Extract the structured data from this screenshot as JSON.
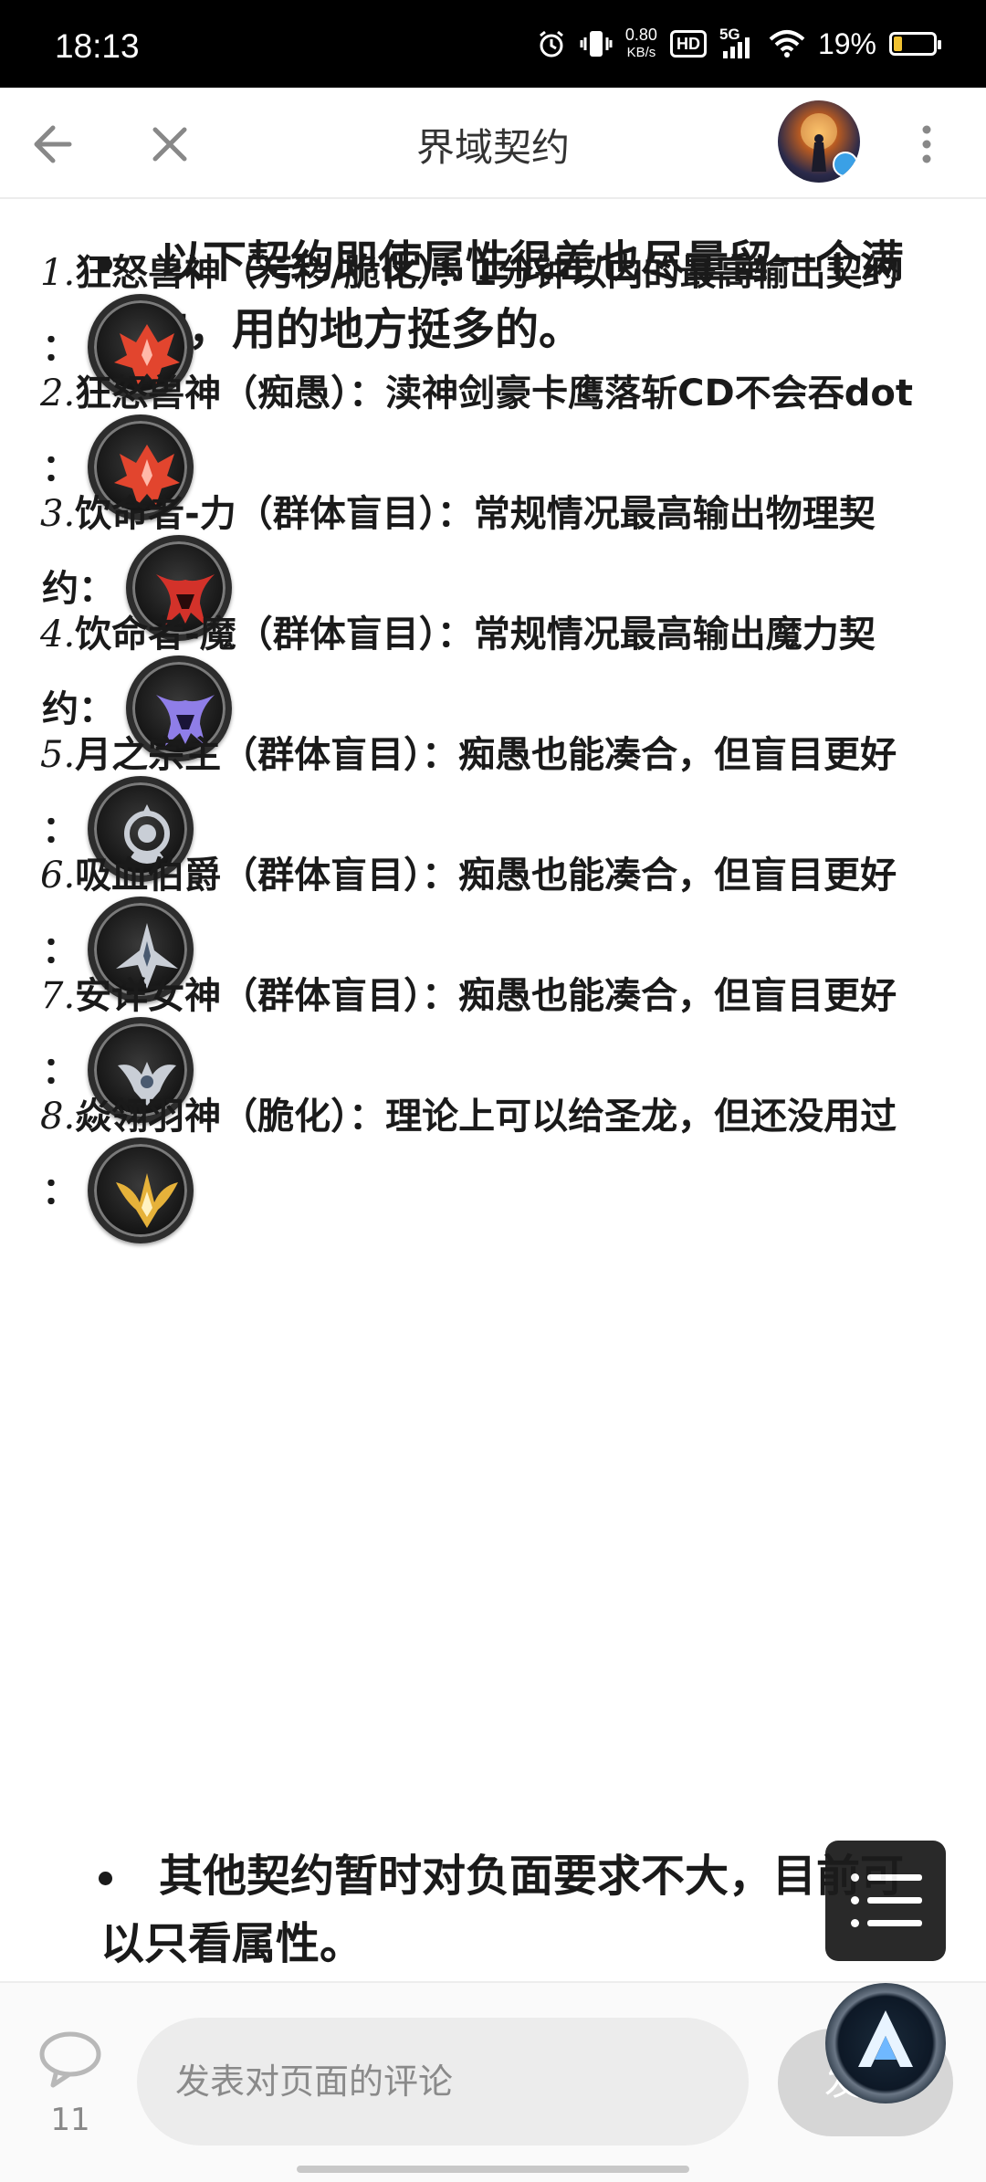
{
  "status_bar": {
    "time": "18:13",
    "net_speed_value": "0.80",
    "net_speed_unit": "KB/s",
    "hd_label": "HD",
    "network": "5G",
    "battery_pct": "19%",
    "battery_level": 0.19,
    "battery_color": "#f1c232"
  },
  "title_bar": {
    "title": "界域契约",
    "back_icon": "arrow-left-icon",
    "close_icon": "close-icon",
    "more_icon": "more-vertical-icon"
  },
  "content": {
    "intro_bullet": "以下契约即使属性很差也尽量留一个满级的，用的地方挺多的。",
    "items": [
      {
        "num": "1.",
        "text": "狂怒兽神（污秽/脆化）：1分钟以内的最高输出契约",
        "line2_prefix": "：",
        "icon": "fury-beast-god-icon",
        "color": "#e2452e"
      },
      {
        "num": "2.",
        "text": "狂怒兽神（痴愚）：渎神剑豪卡鹰落斩CD不会吞dot",
        "line2_prefix": "：",
        "icon": "fury-beast-god-icon",
        "color": "#e2452e"
      },
      {
        "num": "3.",
        "text": "饮命者-力（群体盲目）：常规情况最高输出物理契",
        "line2_prefix": "约：",
        "icon": "lifedrinker-strength-icon",
        "color": "#d3322a"
      },
      {
        "num": "4.",
        "text": "饮命者-魔（群体盲目）：常规情况最高输出魔力契",
        "line2_prefix": "约：",
        "icon": "lifedrinker-magic-icon",
        "color": "#8f7ee8"
      },
      {
        "num": "5.",
        "text": "月之宗主（群体盲目）：痴愚也能凑合，但盲目更好",
        "line2_prefix": "：",
        "icon": "moon-lord-icon",
        "color": "#c9ced6"
      },
      {
        "num": "6.",
        "text": "吸血伯爵（群体盲目）：痴愚也能凑合，但盲目更好",
        "line2_prefix": "：",
        "icon": "vampire-count-icon",
        "color": "#c9ced6"
      },
      {
        "num": "7.",
        "text": "安详女神（群体盲目）：痴愚也能凑合，但盲目更好",
        "line2_prefix": "：",
        "icon": "serene-goddess-icon",
        "color": "#c9ced6"
      },
      {
        "num": "8.",
        "text": "焱翎羽神（脆化）：理论上可以给圣龙，但还没用过",
        "line2_prefix": "：",
        "icon": "flame-feather-god-icon",
        "color": "#e6b23a"
      }
    ],
    "outro_bullet": "其他契约暂时对负面要求不大，目前可以只看属性。"
  },
  "floating": {
    "menu_icon": "list-menu-icon",
    "app_icon": "app-logo-icon"
  },
  "bottom_bar": {
    "comment_count": "11",
    "comment_placeholder": "发表对页面的评论",
    "send_label": "发"
  }
}
